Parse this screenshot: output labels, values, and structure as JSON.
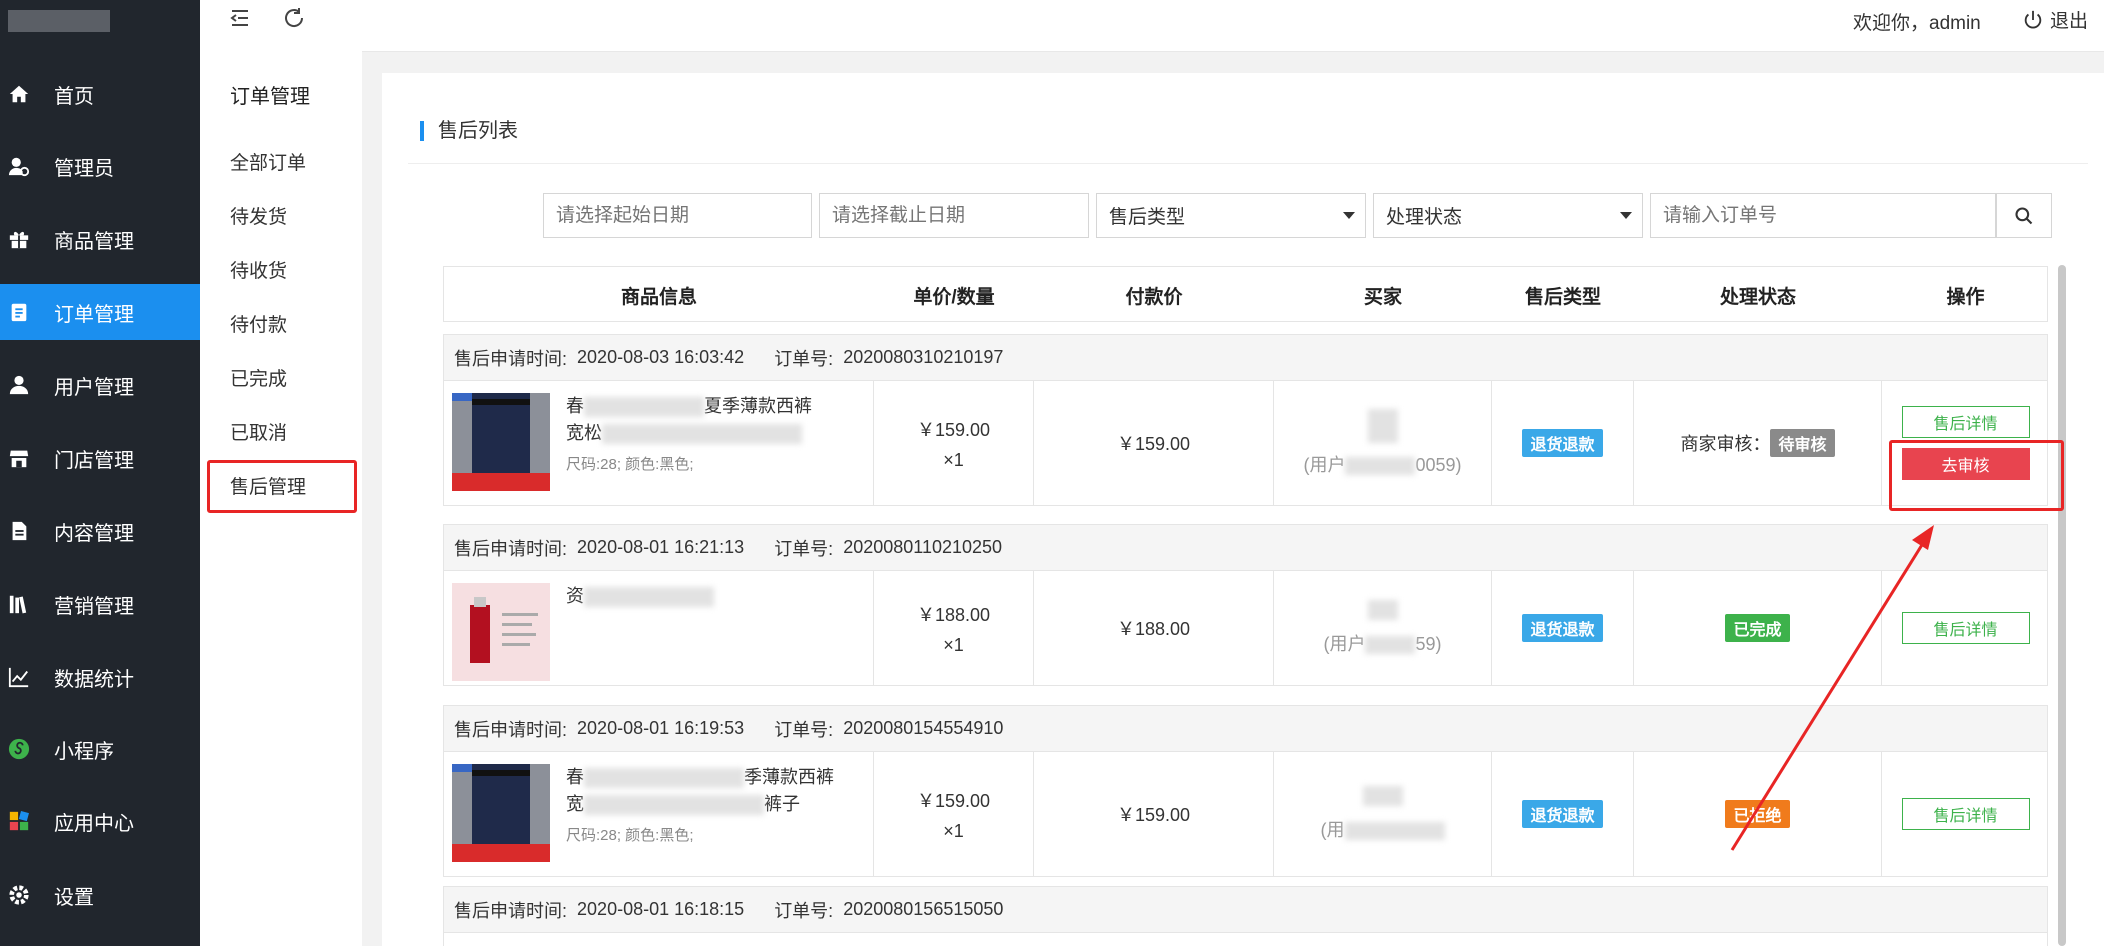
{
  "sidebar": {
    "items": [
      {
        "label": "首页",
        "icon": "home-icon"
      },
      {
        "label": "管理员",
        "icon": "admin-icon"
      },
      {
        "label": "商品管理",
        "icon": "gift-icon"
      },
      {
        "label": "订单管理",
        "icon": "clipboard-icon",
        "active": true
      },
      {
        "label": "用户管理",
        "icon": "user-icon"
      },
      {
        "label": "门店管理",
        "icon": "store-icon"
      },
      {
        "label": "内容管理",
        "icon": "document-icon"
      },
      {
        "label": "营销管理",
        "icon": "books-icon"
      },
      {
        "label": "数据统计",
        "icon": "chart-icon"
      },
      {
        "label": "小程序",
        "icon": "miniprogram-icon"
      },
      {
        "label": "应用中心",
        "icon": "apps-icon"
      },
      {
        "label": "设置",
        "icon": "gear-icon"
      }
    ]
  },
  "submenu": {
    "title": "订单管理",
    "items": [
      "全部订单",
      "待发货",
      "待收货",
      "待付款",
      "已完成",
      "已取消",
      "售后管理"
    ]
  },
  "header": {
    "welcome": "欢迎你，admin",
    "logout": "退出"
  },
  "page": {
    "title": "售后列表",
    "filters": {
      "start_date_placeholder": "请选择起始日期",
      "end_date_placeholder": "请选择截止日期",
      "type_select": "售后类型",
      "status_select": "处理状态",
      "order_no_placeholder": "请输入订单号"
    }
  },
  "table": {
    "columns": [
      "商品信息",
      "单价/数量",
      "付款价",
      "买家",
      "售后类型",
      "处理状态",
      "操作"
    ],
    "apply_time_label": "售后申请时间:",
    "order_no_label": "订单号:",
    "rows": [
      {
        "apply_time": "2020-08-03 16:03:42",
        "order_no": "2020080310210197",
        "name_visible": "夏季薄款西裤",
        "name_prefix": "春",
        "name_line2": "宽松",
        "spec": "尺码:28; 颜色:黑色;",
        "price": "￥159.00",
        "qty": "×1",
        "paid": "￥159.00",
        "buyer": "(用户",
        "buyer_suffix": "0059)",
        "type": "退货退款",
        "status_prefix": "商家审核：",
        "status": "待审核",
        "actions": [
          "售后详情",
          "去审核"
        ]
      },
      {
        "apply_time": "2020-08-01 16:21:13",
        "order_no": "2020080110210250",
        "name_visible": "资",
        "spec": "",
        "price": "￥188.00",
        "qty": "×1",
        "paid": "￥188.00",
        "buyer": "(用户",
        "buyer_suffix": "59)",
        "type": "退货退款",
        "status": "已完成",
        "actions": [
          "售后详情"
        ]
      },
      {
        "apply_time": "2020-08-01 16:19:53",
        "order_no": "2020080154554910",
        "name_visible": "季薄款西裤",
        "name_prefix": "春",
        "name_line2": "宽",
        "name_line2_suffix": "裤子",
        "spec": "尺码:28; 颜色:黑色;",
        "price": "￥159.00",
        "qty": "×1",
        "paid": "￥159.00",
        "buyer": "(用",
        "type": "退货退款",
        "status": "已拒绝",
        "actions": [
          "售后详情"
        ]
      },
      {
        "apply_time": "2020-08-01 16:18:15",
        "order_no": "2020080156515050"
      }
    ]
  },
  "colors": {
    "sidebar_bg": "#21262d",
    "accent": "#1b8fef",
    "highlight_red": "#e82525",
    "success": "#3db24b",
    "warning": "#f07b1c"
  }
}
